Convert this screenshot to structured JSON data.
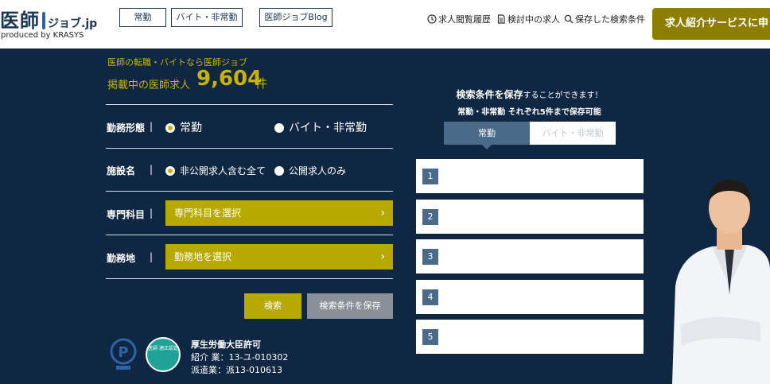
{
  "header": {
    "logo_main": "医師",
    "logo_sub": "ジョブ.jp",
    "logo_tag": "produced by KRASYS",
    "nav": [
      "常勤",
      "バイト・非常勤",
      "医師ジョブBlog"
    ],
    "links": [
      {
        "icon": "history-icon",
        "label": "求人閲覧履歴"
      },
      {
        "icon": "document-icon",
        "label": "検討中の求人"
      },
      {
        "icon": "search-icon",
        "label": "保存した検索条件"
      }
    ],
    "cta_label": "求人紹介サービスに申し込"
  },
  "hero": {
    "tagline": "医師の転職・バイトなら医師ジョブ",
    "count_label": "掲載中の医師求人",
    "count": "9,604",
    "count_unit": "件"
  },
  "form": {
    "employment": {
      "label": "勤務形態",
      "options": [
        {
          "label": "常勤",
          "selected": true
        },
        {
          "label": "バイト・非常勤",
          "selected": false
        }
      ]
    },
    "facility": {
      "label": "施設名",
      "options": [
        {
          "label": "非公開求人含む全て",
          "selected": true
        },
        {
          "label": "公開求人のみ",
          "selected": false
        }
      ]
    },
    "specialty": {
      "label": "専門科目",
      "button": "専門科目を選択"
    },
    "location": {
      "label": "勤務地",
      "button": "勤務地を選択"
    },
    "pipe": "|",
    "search_label": "検索",
    "save_label": "検索条件を保存"
  },
  "license": {
    "line1": "厚生労働大臣許可",
    "line2": "紹介 業：13-ユ-010302",
    "line3": "派遣業：派13-010613",
    "badge_text": "医師 適正認定"
  },
  "saved": {
    "title_main": "検索条件を保存",
    "title_rest": "することができます！",
    "subtitle": "常勤・非常勤 それぞれ5件まで保存可能",
    "tabs": [
      "常勤",
      "バイト・非常勤"
    ],
    "slots": [
      "1",
      "2",
      "3",
      "4",
      "5"
    ]
  },
  "colors": {
    "background": "#0f2742",
    "accent": "#b7a900",
    "accent_text": "#c8b400",
    "tab_active": "#4a6a89"
  }
}
